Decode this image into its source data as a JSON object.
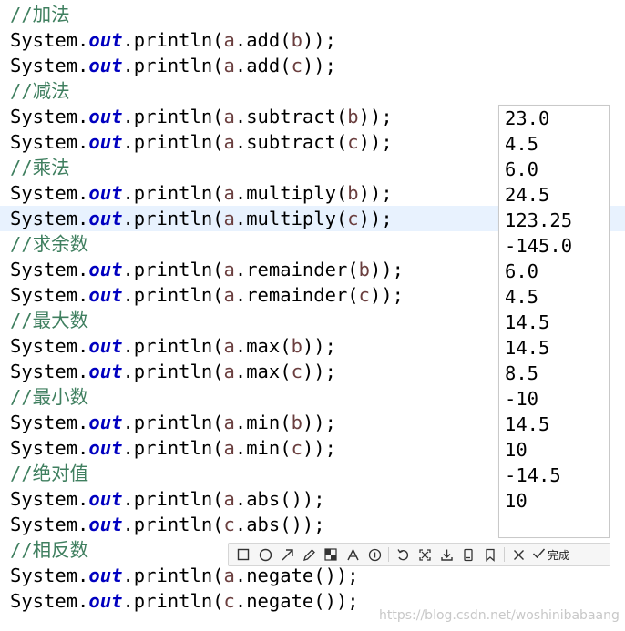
{
  "code": {
    "lines": [
      {
        "comment": "//加法"
      },
      {
        "pre": "System.",
        "kw": "out",
        "mid": ".println(",
        "v": "a",
        "post": ".add(",
        "v2": "b",
        "end": "));"
      },
      {
        "pre": "System.",
        "kw": "out",
        "mid": ".println(",
        "v": "a",
        "post": ".add(",
        "v2": "c",
        "end": "));"
      },
      {
        "comment": "//减法"
      },
      {
        "pre": "System.",
        "kw": "out",
        "mid": ".println(",
        "v": "a",
        "post": ".subtract(",
        "v2": "b",
        "end": "));"
      },
      {
        "pre": "System.",
        "kw": "out",
        "mid": ".println(",
        "v": "a",
        "post": ".subtract(",
        "v2": "c",
        "end": "));"
      },
      {
        "comment": "//乘法"
      },
      {
        "pre": "System.",
        "kw": "out",
        "mid": ".println(",
        "v": "a",
        "post": ".multiply(",
        "v2": "b",
        "end": "));"
      },
      {
        "pre": "System.",
        "kw": "out",
        "mid": ".println(",
        "v": "a",
        "post": ".multiply(",
        "v2": "c",
        "end": "));"
      },
      {
        "comment": "//求余数"
      },
      {
        "pre": "System.",
        "kw": "out",
        "mid": ".println(",
        "v": "a",
        "post": ".remainder(",
        "v2": "b",
        "end": "));"
      },
      {
        "pre": "System.",
        "kw": "out",
        "mid": ".println(",
        "v": "a",
        "post": ".remainder(",
        "v2": "c",
        "end": "));"
      },
      {
        "comment": "//最大数"
      },
      {
        "pre": "System.",
        "kw": "out",
        "mid": ".println(",
        "v": "a",
        "post": ".max(",
        "v2": "b",
        "end": "));"
      },
      {
        "pre": "System.",
        "kw": "out",
        "mid": ".println(",
        "v": "a",
        "post": ".max(",
        "v2": "c",
        "end": "));"
      },
      {
        "comment": "//最小数"
      },
      {
        "pre": "System.",
        "kw": "out",
        "mid": ".println(",
        "v": "a",
        "post": ".min(",
        "v2": "b",
        "end": "));"
      },
      {
        "pre": "System.",
        "kw": "out",
        "mid": ".println(",
        "v": "a",
        "post": ".min(",
        "v2": "c",
        "end": "));"
      },
      {
        "comment": "//绝对值"
      },
      {
        "pre": "System.",
        "kw": "out",
        "mid": ".println(",
        "v": "a",
        "post": ".abs());",
        "v2": "",
        "end": ""
      },
      {
        "pre": "System.",
        "kw": "out",
        "mid": ".println(",
        "v": "c",
        "post": ".abs());",
        "v2": "",
        "end": ""
      },
      {
        "comment": "//相反数"
      },
      {
        "pre": "System.",
        "kw": "out",
        "mid": ".println(",
        "v": "a",
        "post": ".negate());",
        "v2": "",
        "end": ""
      },
      {
        "pre": "System.",
        "kw": "out",
        "mid": ".println(",
        "v": "c",
        "post": ".negate());",
        "v2": "",
        "end": ""
      }
    ],
    "highlighted_line": 8
  },
  "output": [
    "23.0",
    "4.5",
    "6.0",
    "24.5",
    "123.25",
    "-145.0",
    "6.0",
    "4.5",
    "14.5",
    "14.5",
    "8.5",
    "-10",
    "14.5",
    "10",
    "-14.5",
    "10"
  ],
  "toolbar": {
    "icons": [
      "rectangle-icon",
      "ellipse-icon",
      "arrow-icon",
      "pen-icon",
      "mosaic-icon",
      "text-icon",
      "number-marker-icon",
      "undo-icon",
      "pin-icon",
      "download-icon",
      "save-icon",
      "bookmark-icon",
      "close-icon"
    ],
    "done_label": "完成"
  },
  "watermark": "https://blog.csdn.net/woshinibabaang",
  "colors": {
    "comment": "#3f7f5f",
    "keyword": "#0000c0",
    "variable": "#6a3e3e",
    "highlight": "#e8f2fe"
  }
}
